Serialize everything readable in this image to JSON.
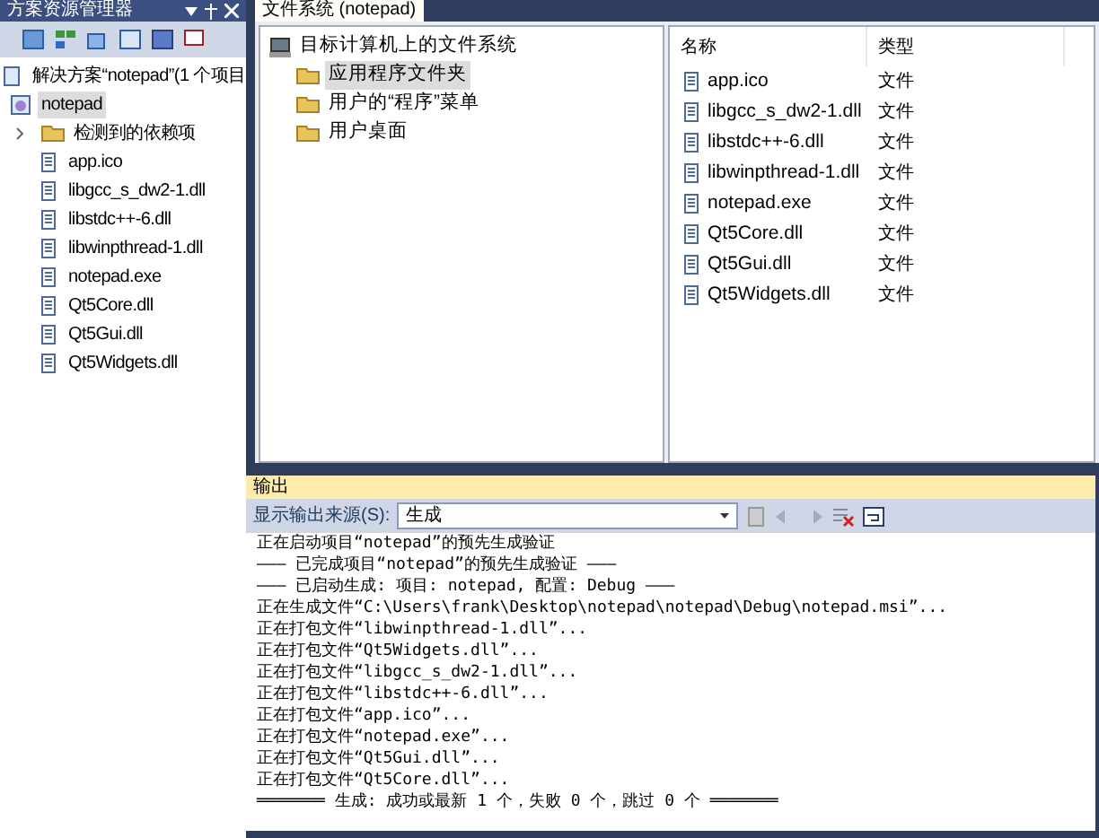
{
  "solution_explorer": {
    "title": "方案资源管理器",
    "tree": [
      {
        "label": "解决方案“notepad”(1 个项目",
        "kind": "solution",
        "selected": false,
        "children": [
          {
            "label": "notepad",
            "kind": "project",
            "selected": true,
            "children": [
              {
                "label": "检测到的依赖项",
                "kind": "folder",
                "selected": false,
                "expanded": false
              },
              {
                "label": "app.ico",
                "kind": "file",
                "selected": false
              },
              {
                "label": "libgcc_s_dw2-1.dll",
                "kind": "file",
                "selected": false
              },
              {
                "label": "libstdc++-6.dll",
                "kind": "file",
                "selected": false
              },
              {
                "label": "libwinpthread-1.dll",
                "kind": "file",
                "selected": false
              },
              {
                "label": "notepad.exe",
                "kind": "file",
                "selected": false
              },
              {
                "label": "Qt5Core.dll",
                "kind": "file",
                "selected": false
              },
              {
                "label": "Qt5Gui.dll",
                "kind": "file",
                "selected": false
              },
              {
                "label": "Qt5Widgets.dll",
                "kind": "file",
                "selected": false
              }
            ]
          }
        ]
      }
    ]
  },
  "file_system": {
    "tab": "文件系统 (notepad)",
    "tree": [
      {
        "label": "目标计算机上的文件系统",
        "kind": "computer",
        "selected": false,
        "children": [
          {
            "label": "应用程序文件夹",
            "kind": "folder",
            "selected": true
          },
          {
            "label": "用户的“程序”菜单",
            "kind": "folder",
            "selected": false
          },
          {
            "label": "用户桌面",
            "kind": "folder",
            "selected": false
          }
        ]
      }
    ],
    "columns": [
      "名称",
      "类型"
    ],
    "rows": [
      {
        "name": "app.ico",
        "type": "文件"
      },
      {
        "name": "libgcc_s_dw2-1.dll",
        "type": "文件"
      },
      {
        "name": "libstdc++-6.dll",
        "type": "文件"
      },
      {
        "name": "libwinpthread-1.dll",
        "type": "文件"
      },
      {
        "name": "notepad.exe",
        "type": "文件"
      },
      {
        "name": "Qt5Core.dll",
        "type": "文件"
      },
      {
        "name": "Qt5Gui.dll",
        "type": "文件"
      },
      {
        "name": "Qt5Widgets.dll",
        "type": "文件"
      }
    ]
  },
  "output": {
    "title": "输出",
    "source_label": "显示输出来源(S):",
    "source_value": "生成",
    "lines": [
      "正在启动项目“notepad”的预先生成验证",
      "——— 已完成项目“notepad”的预先生成验证 ———",
      "——— 已启动生成: 项目: notepad, 配置: Debug ———",
      "正在生成文件“C:\\Users\\frank\\Desktop\\notepad\\notepad\\Debug\\notepad.msi”...",
      "正在打包文件“libwinpthread-1.dll”...",
      "正在打包文件“Qt5Widgets.dll”...",
      "正在打包文件“libgcc_s_dw2-1.dll”...",
      "正在打包文件“libstdc++-6.dll”...",
      "正在打包文件“app.ico”...",
      "正在打包文件“notepad.exe”...",
      "正在打包文件“Qt5Gui.dll”...",
      "正在打包文件“Qt5Core.dll”...",
      "═══════ 生成: 成功或最新 1 个，失败 0 个，跳过 0 个 ═══════"
    ]
  }
}
